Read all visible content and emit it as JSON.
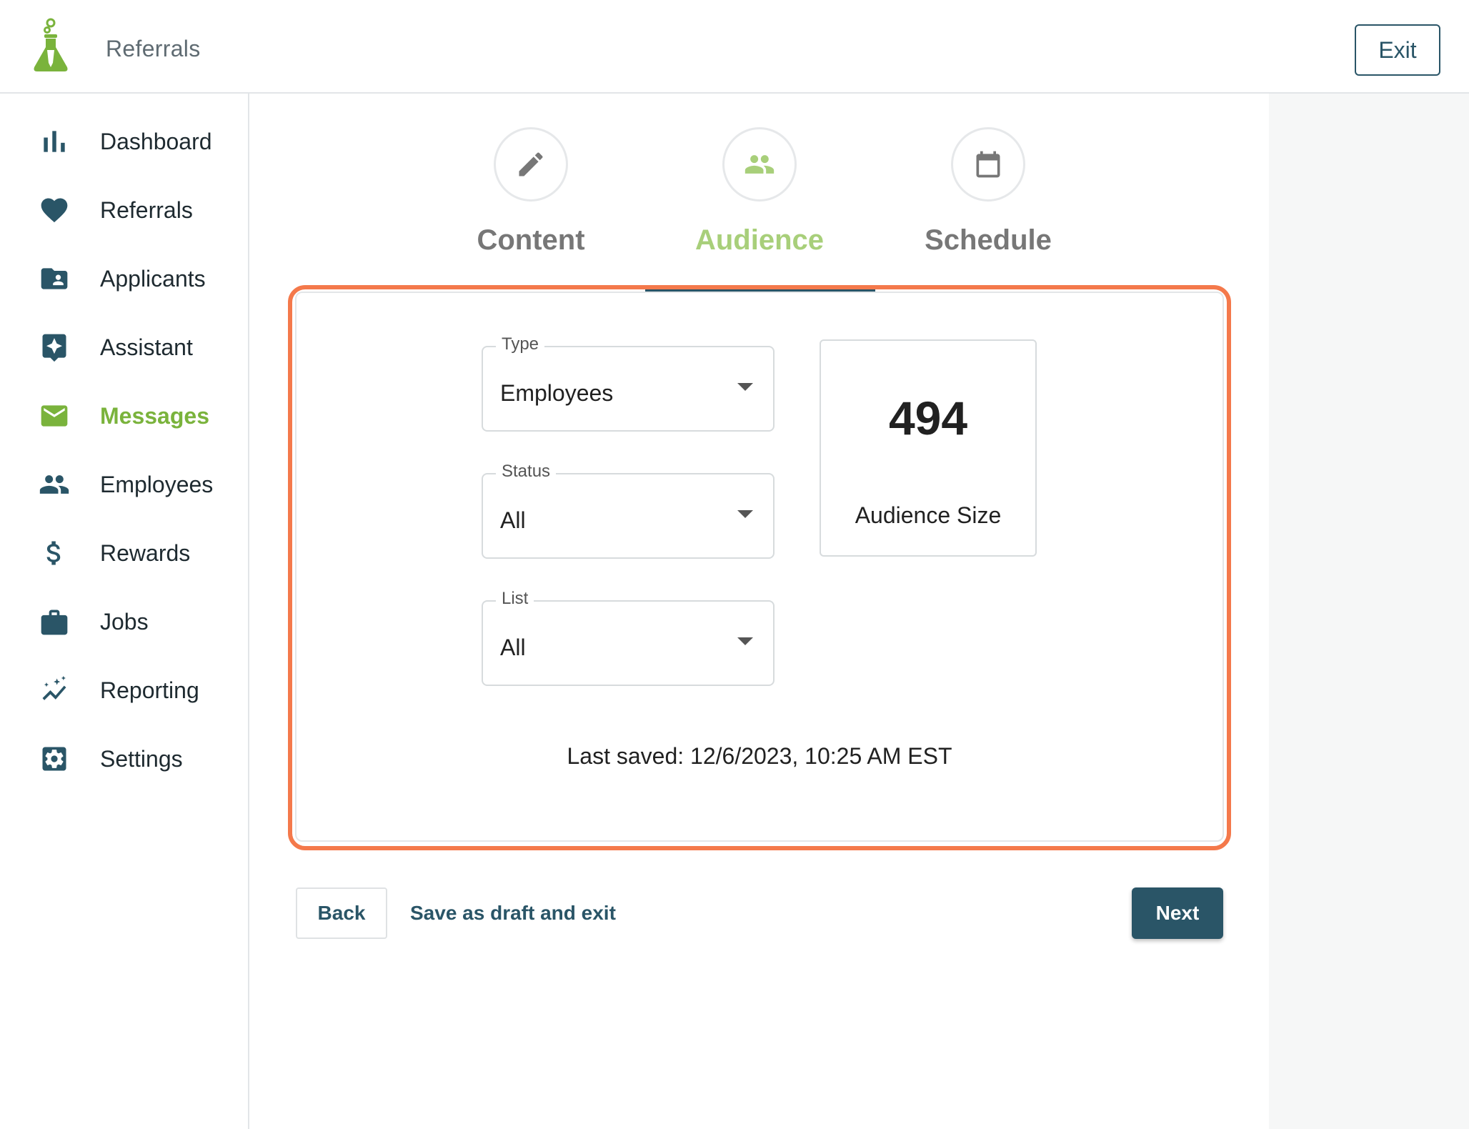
{
  "header": {
    "app_title": "Referrals",
    "exit_label": "Exit",
    "logo_icon": "flask-logo-icon"
  },
  "sidebar": {
    "items": [
      {
        "label": "Dashboard",
        "icon": "bar-chart-icon",
        "active": false
      },
      {
        "label": "Referrals",
        "icon": "heart-icon",
        "active": false
      },
      {
        "label": "Applicants",
        "icon": "folder-person-icon",
        "active": false
      },
      {
        "label": "Assistant",
        "icon": "sparkle-icon",
        "active": false
      },
      {
        "label": "Messages",
        "icon": "mail-icon",
        "active": true
      },
      {
        "label": "Employees",
        "icon": "people-icon",
        "active": false
      },
      {
        "label": "Rewards",
        "icon": "dollar-icon",
        "active": false
      },
      {
        "label": "Jobs",
        "icon": "briefcase-icon",
        "active": false
      },
      {
        "label": "Reporting",
        "icon": "trend-sparkle-icon",
        "active": false
      },
      {
        "label": "Settings",
        "icon": "gear-icon",
        "active": false
      }
    ]
  },
  "stepper": {
    "steps": [
      {
        "label": "Content",
        "icon": "pencil-icon",
        "active": false
      },
      {
        "label": "Audience",
        "icon": "people-icon",
        "active": true
      },
      {
        "label": "Schedule",
        "icon": "calendar-icon",
        "active": false
      }
    ]
  },
  "form": {
    "type": {
      "legend": "Type",
      "value": "Employees"
    },
    "status": {
      "legend": "Status",
      "value": "All"
    },
    "list": {
      "legend": "List",
      "value": "All"
    }
  },
  "audience": {
    "size": "494",
    "label": "Audience Size"
  },
  "last_saved": "Last saved: 12/6/2023, 10:25 AM EST",
  "footer": {
    "back_label": "Back",
    "draft_label": "Save as draft and exit",
    "next_label": "Next"
  },
  "colors": {
    "primary": "#2a5567",
    "accent": "#7ab33c",
    "accent_light": "#a8cf7a",
    "highlight": "#f4794b"
  }
}
